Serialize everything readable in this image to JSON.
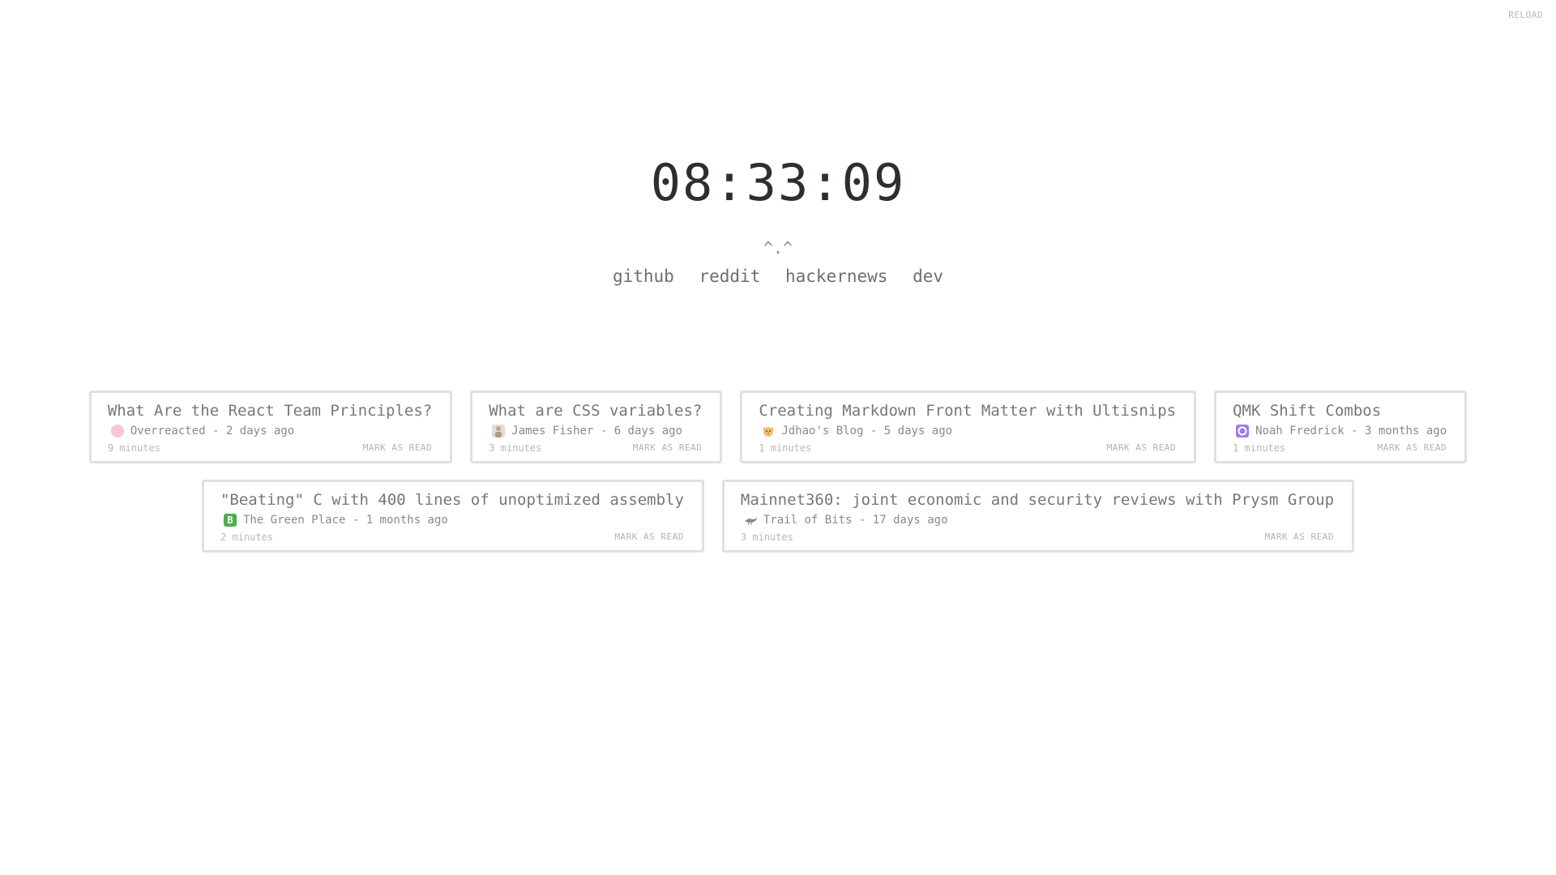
{
  "reload_label": "RELOAD",
  "clock": "08:33:09",
  "face": "^.^",
  "nav": [
    "github",
    "reddit",
    "hackernews",
    "dev"
  ],
  "mark_as_read_label": "MARK AS READ",
  "cards": [
    {
      "title": "What Are the React Team Principles?",
      "source": "Overreacted",
      "age": "2 days ago",
      "read_time": "9 minutes",
      "icon": "pink-circle-icon",
      "icon_color": "#f7c6d8"
    },
    {
      "title": "What are CSS variables?",
      "source": "James Fisher",
      "age": "6 days ago",
      "read_time": "3 minutes",
      "icon": "portrait-icon",
      "icon_color": "#d9cfc4"
    },
    {
      "title": "Creating Markdown Front Matter with Ultisnips",
      "source": "Jdhao's Blog",
      "age": "5 days ago",
      "read_time": "1 minutes",
      "icon": "cat-face-icon",
      "icon_color": "#f2c36b"
    },
    {
      "title": "QMK Shift Combos",
      "source": "Noah Fredrick",
      "age": "3 months ago",
      "read_time": "1 minutes",
      "icon": "purple-ring-icon",
      "icon_color": "#a27be0"
    },
    {
      "title": "\"Beating\" C with 400 lines of unoptimized assembly",
      "source": "The Green Place",
      "age": "1 months ago",
      "read_time": "2 minutes",
      "icon": "green-b-icon",
      "icon_color": "#4caf50",
      "icon_letter": "B"
    },
    {
      "title": "Mainnet360: joint economic and security reviews with Prysm Group",
      "source": "Trail of Bits",
      "age": "17 days ago",
      "read_time": "3 minutes",
      "icon": "bird-icon",
      "icon_color": "#888888"
    }
  ]
}
